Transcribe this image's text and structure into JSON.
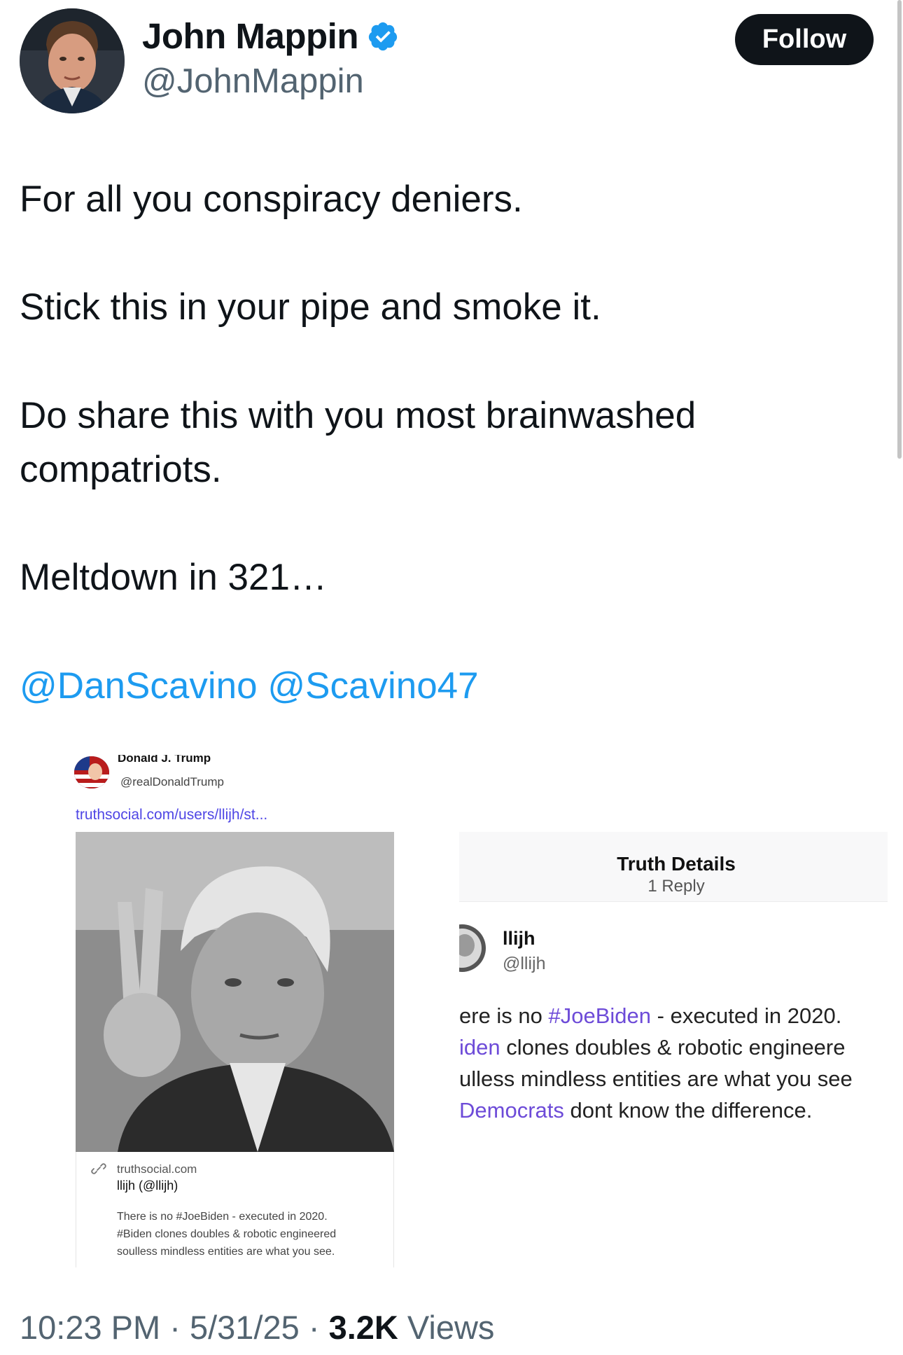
{
  "author": {
    "name": "John Mappin",
    "handle": "@JohnMappin",
    "verified_icon": "verified-badge-icon",
    "follow_label": "Follow"
  },
  "tweet": {
    "lines": [
      "For all you conspiracy deniers.",
      "Stick this in your pipe and smoke it.",
      "Do share this with you most brainwashed",
      "compatriots.",
      "Meltdown in 321…"
    ],
    "mentions": [
      "@DanScavino",
      "@Scavino47"
    ]
  },
  "media": {
    "left_post": {
      "name": "Donald J. Trump",
      "handle": "@realDonaldTrump",
      "link": "truthsocial.com/users/llijh/st...",
      "card_domain": "truthsocial.com",
      "card_title": "llijh (@llijh)",
      "card_desc": [
        "There is no #JoeBiden - executed in 2020.",
        "#Biden clones doubles & robotic engineered",
        "soulless mindless entities are what you see."
      ]
    },
    "right_post": {
      "header_title": "Truth Details",
      "header_sub": "1 Reply",
      "reply_name": "llijh",
      "reply_handle": "@llijh",
      "lines": [
        {
          "pre": "ere is no ",
          "tag": "#JoeBiden",
          "post": " - executed in 2020."
        },
        {
          "pre": "",
          "tag": "iden",
          "post": " clones doubles & robotic engineere"
        },
        {
          "pre": "ulless mindless entities are what you see",
          "tag": "",
          "post": ""
        },
        {
          "pre": "",
          "tag": "Democrats",
          "post": " dont know the difference."
        }
      ]
    }
  },
  "footer": {
    "time": "10:23 PM",
    "sep1": " · ",
    "date": "5/31/25",
    "sep2": " · ",
    "views_count": "3.2K",
    "views_label": " Views"
  },
  "colors": {
    "accent": "#1d9bf0",
    "text": "#0f1419",
    "muted": "#536471",
    "follow_bg": "#0f1419",
    "truth_tag": "#6d4bd8"
  }
}
